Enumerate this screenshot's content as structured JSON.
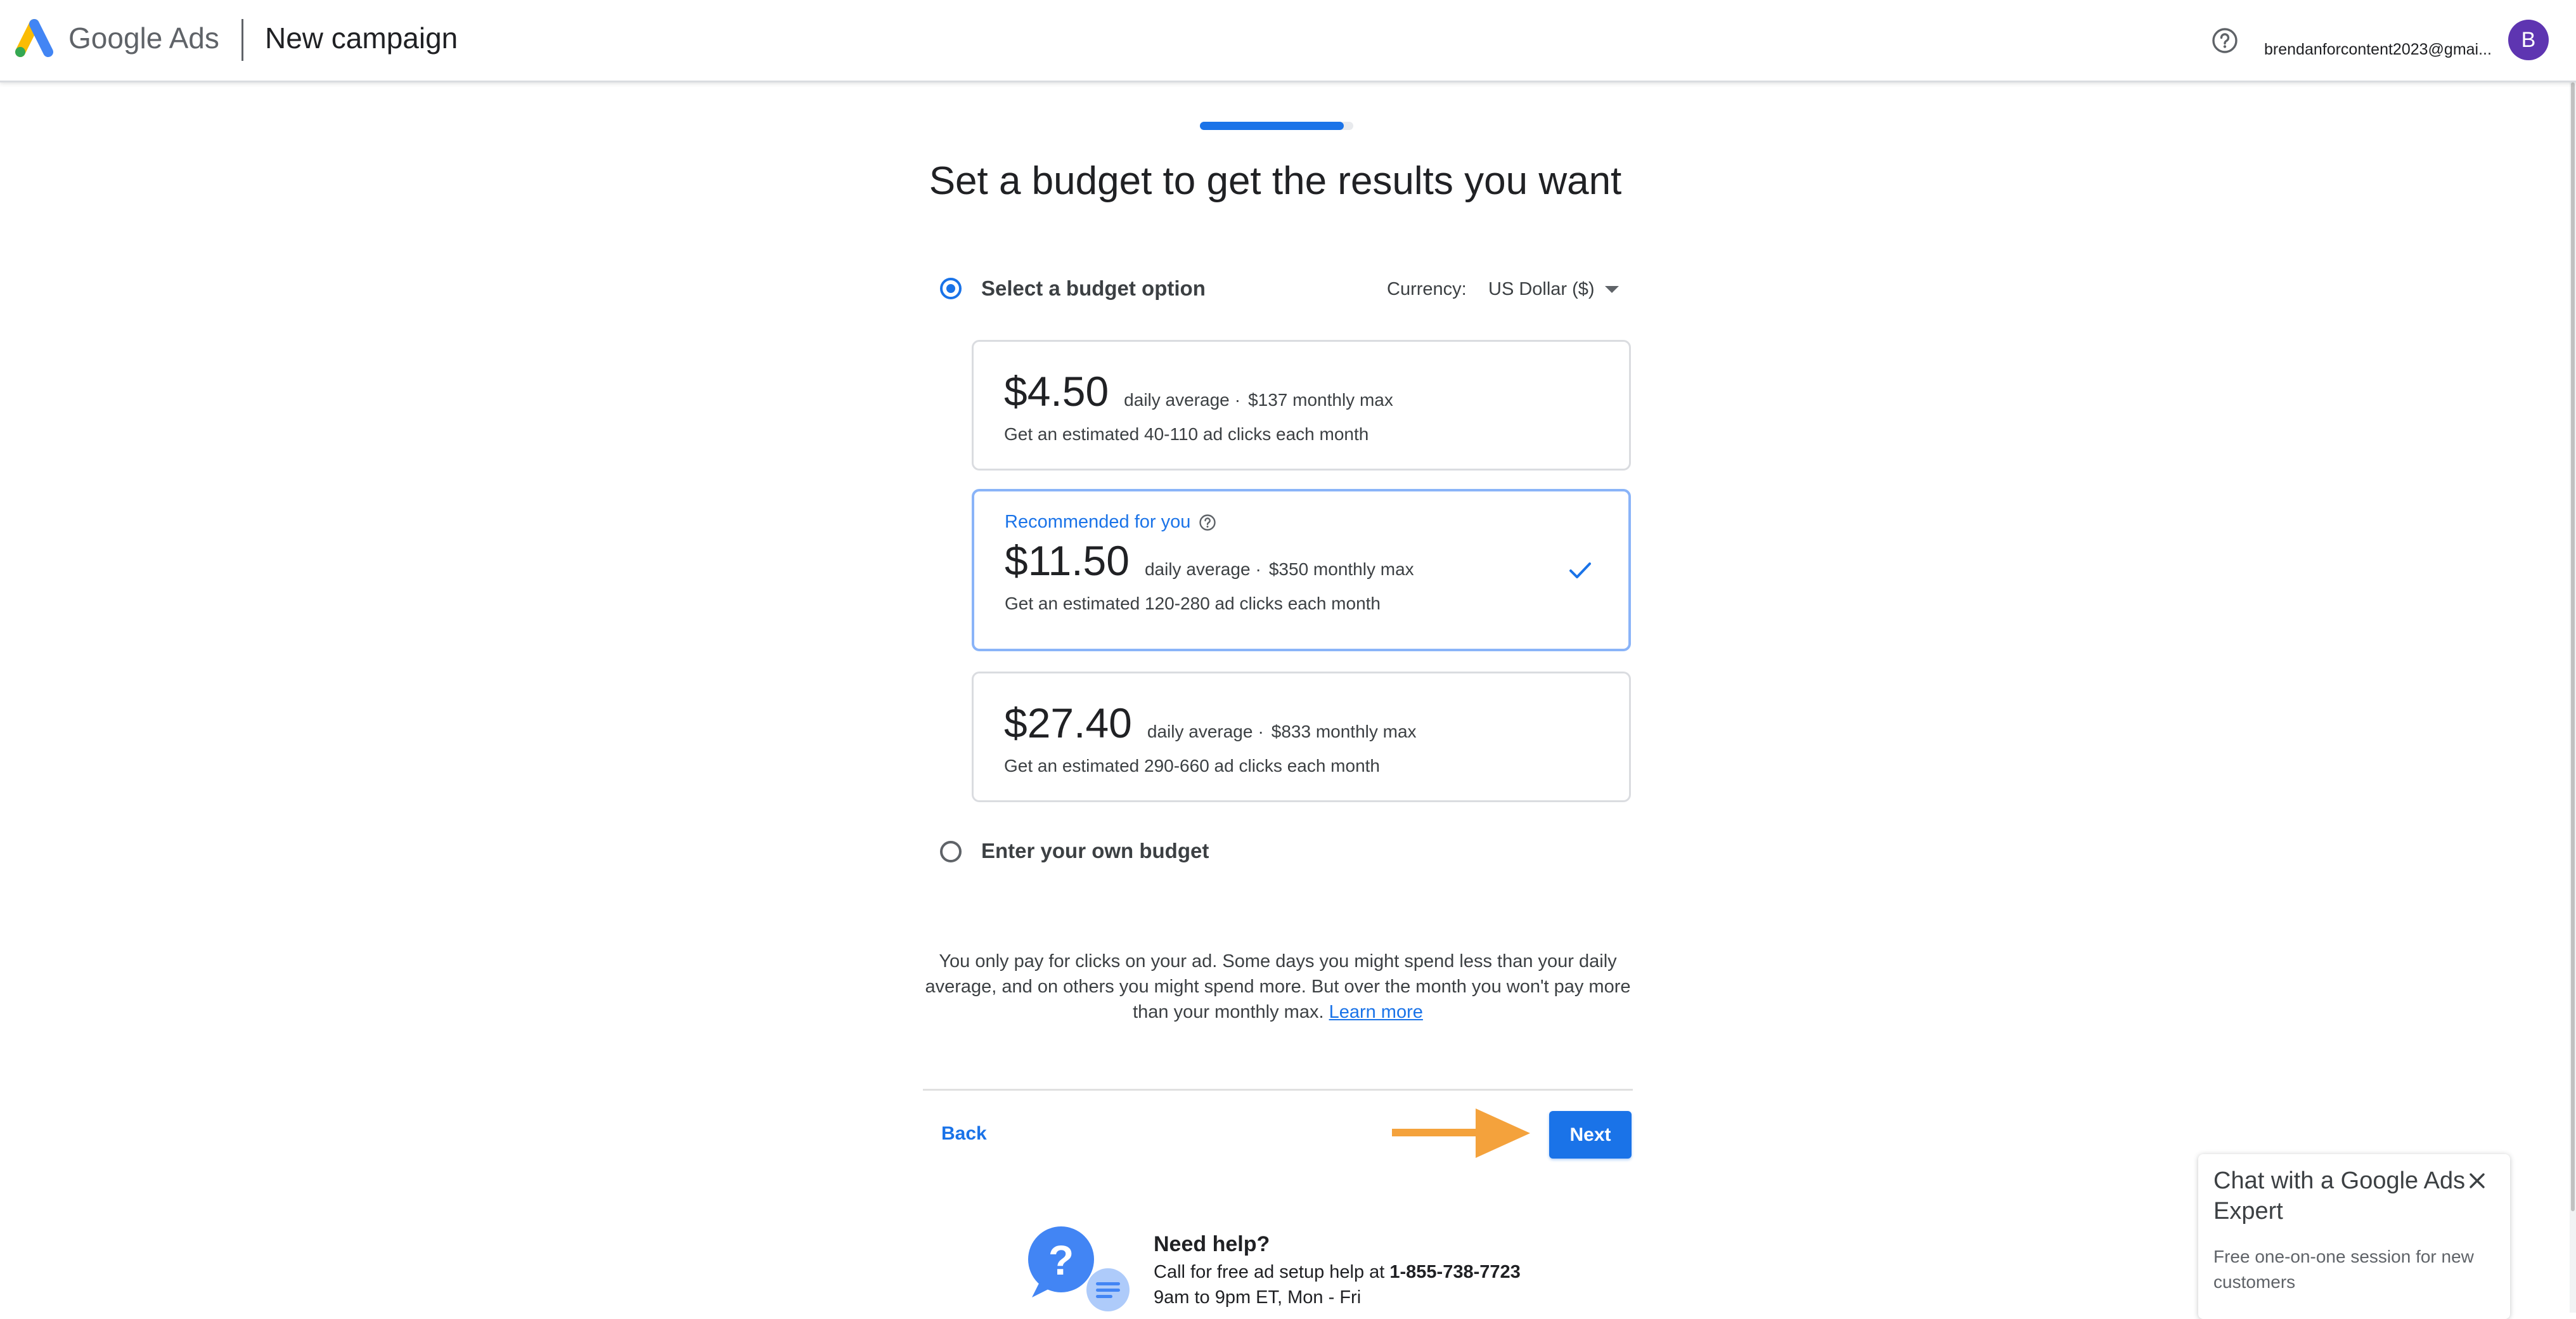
{
  "header": {
    "brand_google": "Google",
    "brand_ads": "Ads",
    "page_title": "New campaign",
    "account_email": "brendanforcontent2023@gmai...",
    "avatar_letter": "B"
  },
  "progress": {
    "fraction": 0.94
  },
  "title": "Set a budget to get the results you want",
  "budget_option": {
    "label": "Select a budget option",
    "selected": true,
    "currency_label": "Currency:",
    "currency_value": "US Dollar ($)"
  },
  "options": [
    {
      "price": "$4.50",
      "daily": "daily average",
      "sep": "·",
      "monthly": "$137 monthly max",
      "estimate": "Get an estimated 40-110 ad clicks each month",
      "recommended": false
    },
    {
      "recommended_label": "Recommended for you",
      "price": "$11.50",
      "daily": "daily average",
      "sep": "·",
      "monthly": "$350 monthly max",
      "estimate": "Get an estimated 120-280 ad clicks each month",
      "recommended": true,
      "selected": true
    },
    {
      "price": "$27.40",
      "daily": "daily average",
      "sep": "·",
      "monthly": "$833 monthly max",
      "estimate": "Get an estimated 290-660 ad clicks each month",
      "recommended": false
    }
  ],
  "own_budget": {
    "label": "Enter your own budget",
    "selected": false
  },
  "info": {
    "text": "You only pay for clicks on your ad. Some days you might spend less than your daily average, and on others you might spend more. But over the month you won't pay more than your monthly max.",
    "link": "Learn more"
  },
  "footer": {
    "back_label": "Back",
    "next_label": "Next"
  },
  "need_help": {
    "title": "Need help?",
    "call_prefix": "Call for free ad setup help at ",
    "phone": "1-855-738-7723",
    "hours": "9am to 9pm ET, Mon - Fri"
  },
  "chat": {
    "title": "Chat with a Google Ads Expert",
    "subtitle": "Free one-on-one session for new customers"
  },
  "colors": {
    "accent": "#1a73e8",
    "annotation_arrow": "#f4a23c",
    "avatar": "#5e35b1"
  },
  "icons": {
    "help_top": "help-circle-icon",
    "check": "check-icon",
    "close": "close-icon",
    "caret": "caret-down-icon"
  }
}
